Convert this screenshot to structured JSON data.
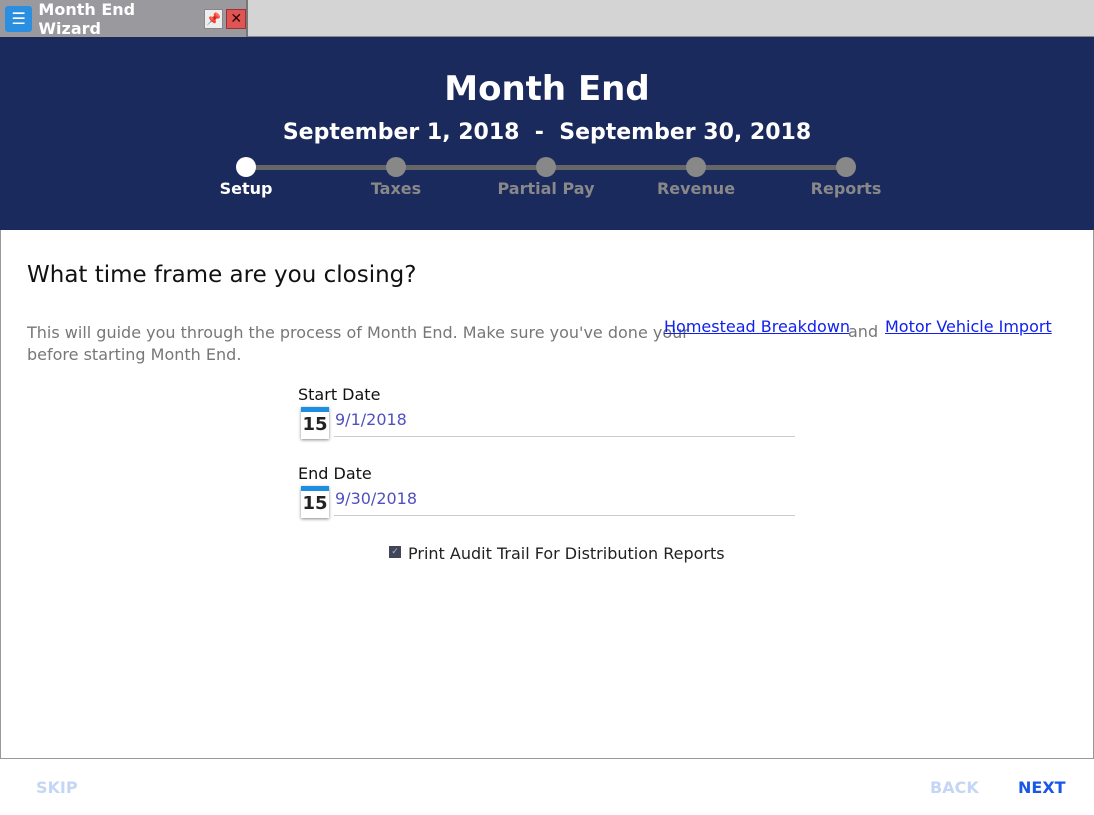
{
  "window": {
    "tab_title": "Month End Wizard",
    "icon": "checklist-icon"
  },
  "header": {
    "title": "Month End",
    "start": "September 1, 2018",
    "separator": "-",
    "end": "September 30, 2018",
    "steps": [
      {
        "label": "Setup",
        "active": true
      },
      {
        "label": "Taxes",
        "active": false
      },
      {
        "label": "Partial Pay",
        "active": false
      },
      {
        "label": "Revenue",
        "active": false
      },
      {
        "label": "Reports",
        "active": false
      }
    ]
  },
  "main": {
    "question": "What time frame are you closing?",
    "description_line1": "This will guide you through the process of Month End.  Make sure you've done your",
    "description_line2": "before starting Month End.",
    "link1": "Homestead Breakdown",
    "and": "and",
    "link2": "Motor Vehicle Import",
    "start_label": "Start Date",
    "start_value": "9/1/2018",
    "calendar_day": "15",
    "end_label": "End Date",
    "end_value": "9/30/2018",
    "checkbox_label": "Print Audit Trail For Distribution Reports",
    "checkbox_checked": true
  },
  "footer": {
    "skip": "SKIP",
    "back": "BACK",
    "next": "NEXT"
  },
  "colors": {
    "header_bg": "#1b2a5c",
    "next": "#1a56e8",
    "disabled": "#c5d6f5"
  }
}
